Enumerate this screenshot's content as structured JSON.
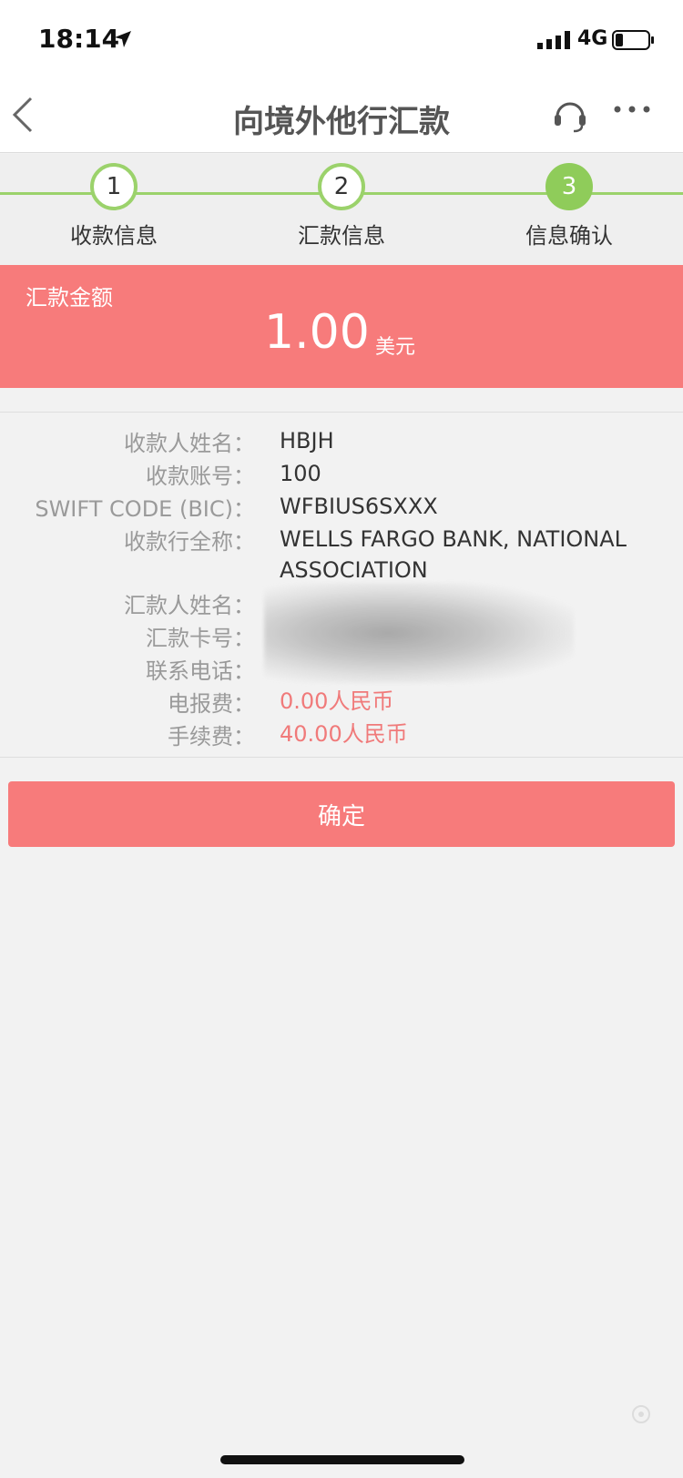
{
  "status_bar": {
    "time": "18:14",
    "network": "4G"
  },
  "nav": {
    "title": "向境外他行汇款"
  },
  "steps": [
    {
      "number": "1",
      "label": "收款信息"
    },
    {
      "number": "2",
      "label": "汇款信息"
    },
    {
      "number": "3",
      "label": "信息确认"
    }
  ],
  "amount": {
    "label": "汇款金额",
    "value": "1.00",
    "unit": "美元"
  },
  "details": [
    {
      "label": "收款人姓名：",
      "value": "HBJH"
    },
    {
      "label": "收款账号：",
      "value": "100"
    },
    {
      "label": "SWIFT CODE (BIC)：",
      "value": "WFBIUS6SXXX"
    },
    {
      "label": "收款行全称：",
      "value": "WELLS FARGO BANK, NATIONAL ASSOCIATION"
    },
    {
      "label": "汇款人姓名：",
      "value": ""
    },
    {
      "label": "汇款卡号：",
      "value": ""
    },
    {
      "label": "联系电话：",
      "value": ""
    },
    {
      "label": "电报费：",
      "value": "0.00人民币"
    },
    {
      "label": "手续费：",
      "value": "40.00人民币"
    }
  ],
  "confirm_label": "确定",
  "colors": {
    "accent": "#f77b7b",
    "step_green": "#8fcc5a"
  }
}
